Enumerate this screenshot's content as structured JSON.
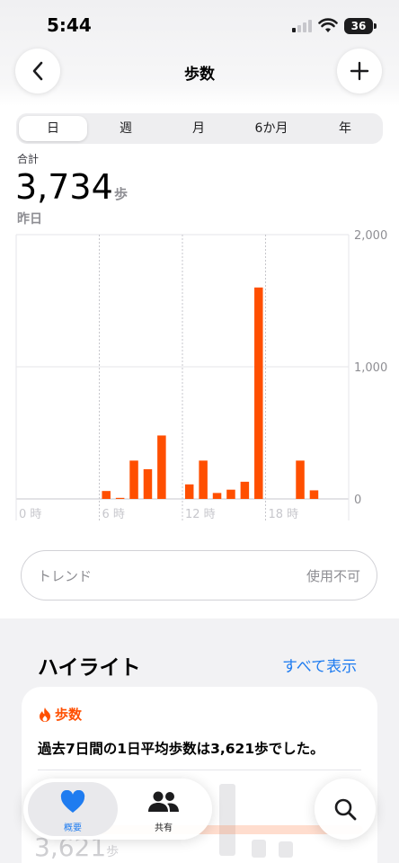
{
  "status_bar": {
    "time": "5:44",
    "battery": "36"
  },
  "nav": {
    "title": "歩数"
  },
  "range_tabs": [
    {
      "label": "日",
      "selected": true
    },
    {
      "label": "週",
      "selected": false
    },
    {
      "label": "月",
      "selected": false
    },
    {
      "label": "6か月",
      "selected": false
    },
    {
      "label": "年",
      "selected": false
    }
  ],
  "summary": {
    "label": "合計",
    "value": "3,734",
    "unit": "歩",
    "date": "昨日"
  },
  "chart_data": {
    "type": "bar",
    "x": [
      0,
      1,
      2,
      3,
      4,
      5,
      6,
      7,
      8,
      9,
      10,
      11,
      12,
      13,
      14,
      15,
      16,
      17,
      18,
      19,
      20,
      21,
      22,
      23
    ],
    "values": [
      0,
      0,
      0,
      0,
      0,
      0,
      60,
      8,
      290,
      225,
      480,
      0,
      110,
      290,
      45,
      70,
      130,
      1600,
      0,
      0,
      290,
      65,
      0,
      0
    ],
    "xtick_labels": [
      "0 時",
      "6 時",
      "12 時",
      "18 時"
    ],
    "xtick_positions": [
      0,
      6,
      12,
      18
    ],
    "ytick_labels": [
      "2,000",
      "1,000",
      "0"
    ],
    "yticks": [
      2000,
      1000,
      0
    ],
    "ylim": [
      0,
      2000
    ],
    "color": "#ff4f00",
    "grid": true,
    "y_axis_side": "right"
  },
  "trend": {
    "label": "トレンド",
    "value": "使用不可"
  },
  "highlights": {
    "title": "ハイライト",
    "show_all": "すべて表示",
    "card": {
      "category": "歩数",
      "text": "過去7日間の1日平均歩数は3,621歩でした。",
      "faded_value": "3,621",
      "faded_unit": "歩"
    }
  },
  "tab_bar": {
    "summary_label": "概要",
    "sharing_label": "共有"
  },
  "colors": {
    "accent": "#ff4f00",
    "link": "#1f7cf0"
  }
}
